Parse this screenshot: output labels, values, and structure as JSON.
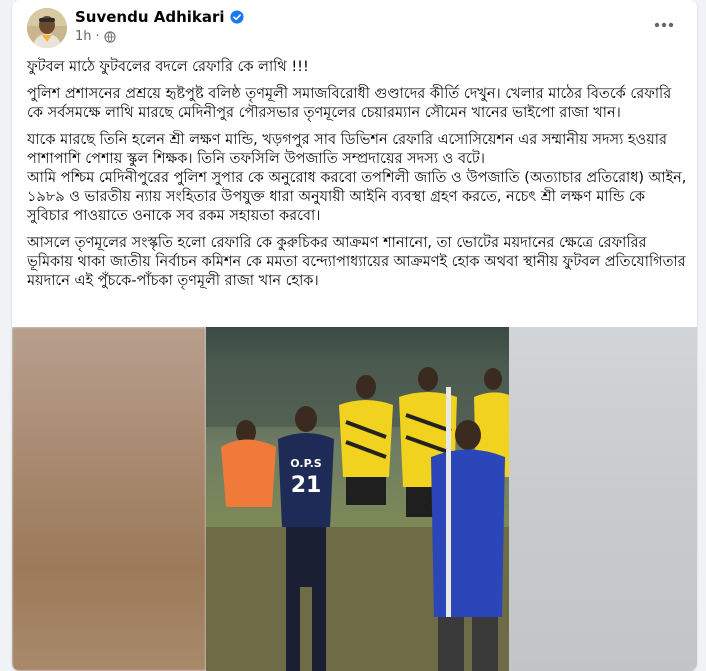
{
  "post": {
    "author": "Suvendu Adhikari",
    "time": "1h",
    "headline": "ফুটবল মাঠে ফুটবলের বদলে রেফারি কে লাথি !!!",
    "paragraphs": [
      "পুলিশ প্রশাসনের প্রশ্রয়ে হৃষ্টপুষ্ট বলিষ্ঠ তৃণমূলী সমাজবিরোধী গুণ্ডাদের কীর্তি দেখুন। খেলার মাঠের বিতর্কে রেফারি কে সর্বসমক্ষে লাথি মারছে মেদিনীপুর পৌরসভার তৃণমূলের চেয়ারম্যান সৌমেন খানের ভাইপো রাজা খান।",
      "যাকে মারছে তিনি হলেন শ্রী লক্ষণ মান্ডি, খড়গপুর সাব ডিভিশন রেফারি এসোসিয়েশন এর সম্মানীয় সদস্য হওয়ার পাশাপাশি পেশায় স্কুল শিক্ষক। তিনি তফসিলি উপজাতি সম্প্রদায়ের সদস্য ও বটে।\nআমি পশ্চিম মেদিনীপুরের পুলিশ সুপার কে অনুরোধ করবো তপশিলী জাতি ও উপজাতি (অত্যাচার প্রতিরোধ) আইন, ১৯৮৯ ও ভারতীয় ন্যায় সংহিতার উপযুক্ত ধারা অনুযায়ী আইনি ব্যবস্থা গ্রহণ করতে, নচেৎ শ্রী লক্ষণ মান্ডি কে সুবিচার পাওয়াতে ওনাকে সব রকম সহায়তা করবো।",
      "আসলে তৃণমূলের সংস্কৃতি হলো রেফারি কে কুরুচিকর আক্রমণ শানানো, তা ভোটের ময়দানের ক্ষেত্রে রেফারির ভূমিকায় থাকা জাতীয় নির্বাচন কমিশন কে মমতা বন্দ্যোপাধ্যায়ের আক্রমণই হোক অথবা স্থানীয় ফুটবল প্রতিযোগিতার ময়দানে এই পুঁচকে-পাঁচকা তৃণমূলী রাজা খান হোক।"
    ],
    "jersey": {
      "team": "O.P.S",
      "number": "21"
    }
  },
  "colors": {
    "verified": "#1877f2",
    "text": "#050505",
    "secondary": "#65676b",
    "background": "#f0f2f5"
  },
  "icons": [
    "verified-badge-icon",
    "globe-icon",
    "more-options-icon"
  ]
}
